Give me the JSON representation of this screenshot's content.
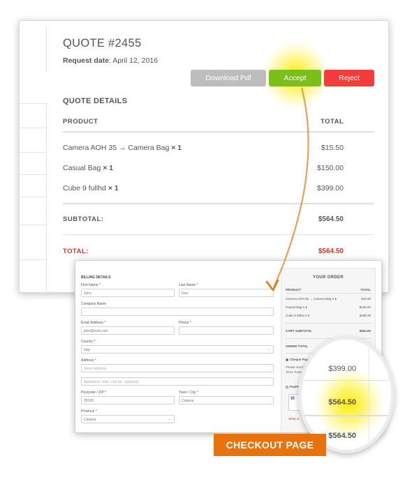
{
  "quote": {
    "title": "QUOTE #2455",
    "request_label": "Request date",
    "request_date": ": April 12, 2016",
    "buttons": {
      "download": "Download Pdf",
      "accept": "Accept",
      "reject": "Reject"
    },
    "details_heading": "QUOTE DETAILS",
    "columns": {
      "product": "PRODUCT",
      "total": "TOTAL"
    },
    "items": [
      {
        "name": "Camera AOH 35 → Camera Bag",
        "qty": "× 1",
        "total": "$15.50"
      },
      {
        "name": "Casual Bag",
        "qty": "× 1",
        "total": "$150.00"
      },
      {
        "name": "Cube 9 fullhd",
        "qty": "× 1",
        "total": "$399.00"
      }
    ],
    "subtotal_label": "SUBTOTAL:",
    "subtotal_value": "$564.50",
    "total_label": "TOTAL:",
    "total_value": "$564.50"
  },
  "checkout": {
    "billing_heading": "BILLING DETAILS",
    "first_name_label": "First Name *",
    "first_name": "John",
    "last_name_label": "Last Name *",
    "last_name": "Doe",
    "company_label": "Company Name",
    "email_label": "Email Address *",
    "email": "john@mail.com",
    "phone_label": "Phone *",
    "country_label": "Country *",
    "country": "Italy",
    "address_label": "Address *",
    "street_placeholder": "Street address",
    "apt_placeholder": "Apartment, suite, unit etc. (optional)",
    "postcode_label": "Postcode / ZIP *",
    "postcode": "95100",
    "town_label": "Town / City *",
    "town": "Catania",
    "province_label": "Province *",
    "province": "Catania",
    "order": {
      "title": "YOUR ORDER",
      "col_product": "PRODUCT",
      "col_total": "TOTAL",
      "items": [
        {
          "name": "Camera AOH 35 → Camera Bag",
          "qty": "× 1",
          "total": "$15.50"
        },
        {
          "name": "Casual Bag",
          "qty": "× 1",
          "total": "$150.00"
        },
        {
          "name": "Cube 9 fullhd",
          "qty": "× 1",
          "total": "$399.00"
        }
      ],
      "cart_subtotal_label": "CART SUBTOTAL",
      "cart_subtotal": "$564.50",
      "order_total_label": "ORDER TOTAL",
      "order_total": "$564.50",
      "cheque_label": "Cheque Payment",
      "cheque_text": "Please send your che... Store Town, Store...",
      "paypal_label": "PayPal",
      "paypal_card": "VI",
      "what_is": "What is"
    }
  },
  "magnifier": {
    "values": [
      "$399.00",
      "$564.50",
      "$564.50"
    ]
  },
  "badge": "CHECKOUT PAGE"
}
